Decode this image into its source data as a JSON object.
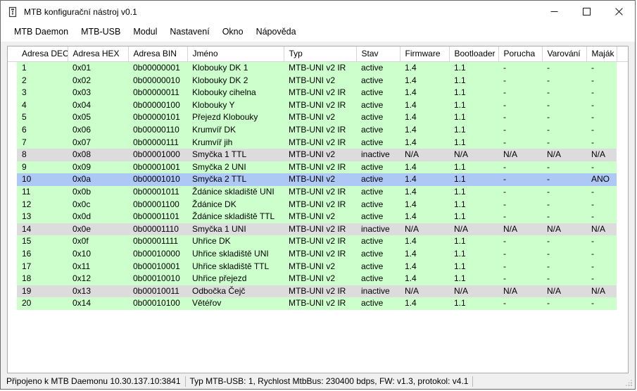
{
  "window": {
    "title": "MTB konfigurační nástroj v0.1",
    "app_icon": "module-icon",
    "minimize_label": "Minimalizovat",
    "maximize_label": "Maximalizovat",
    "close_label": "Zavřít"
  },
  "menu": {
    "items": [
      {
        "label": "MTB Daemon"
      },
      {
        "label": "MTB-USB"
      },
      {
        "label": "Modul"
      },
      {
        "label": "Nastavení"
      },
      {
        "label": "Okno"
      },
      {
        "label": "Nápověda"
      }
    ]
  },
  "table": {
    "columns": [
      {
        "key": "dec",
        "label": "Adresa DEC"
      },
      {
        "key": "hex",
        "label": "Adresa HEX"
      },
      {
        "key": "bin",
        "label": "Adresa BIN"
      },
      {
        "key": "name",
        "label": "Jméno"
      },
      {
        "key": "type",
        "label": "Typ"
      },
      {
        "key": "state",
        "label": "Stav"
      },
      {
        "key": "firmware",
        "label": "Firmware"
      },
      {
        "key": "bootloader",
        "label": "Bootloader"
      },
      {
        "key": "fault",
        "label": "Porucha"
      },
      {
        "key": "warning",
        "label": "Varování"
      },
      {
        "key": "beacon",
        "label": "Maják"
      }
    ],
    "rows": [
      {
        "dec": "1",
        "hex": "0x01",
        "bin": "0b00000001",
        "name": "Klobouky DK 1",
        "type": "MTB-UNI v2 IR",
        "state": "active",
        "firmware": "1.4",
        "bootloader": "1.1",
        "fault": "-",
        "warning": "-",
        "beacon": "-",
        "status": "active"
      },
      {
        "dec": "2",
        "hex": "0x02",
        "bin": "0b00000010",
        "name": "Klobouky DK 2",
        "type": "MTB-UNI v2",
        "state": "active",
        "firmware": "1.4",
        "bootloader": "1.1",
        "fault": "-",
        "warning": "-",
        "beacon": "-",
        "status": "active"
      },
      {
        "dec": "3",
        "hex": "0x03",
        "bin": "0b00000011",
        "name": "Klobouky cihelna",
        "type": "MTB-UNI v2 IR",
        "state": "active",
        "firmware": "1.4",
        "bootloader": "1.1",
        "fault": "-",
        "warning": "-",
        "beacon": "-",
        "status": "active"
      },
      {
        "dec": "4",
        "hex": "0x04",
        "bin": "0b00000100",
        "name": "Klobouky Y",
        "type": "MTB-UNI v2 IR",
        "state": "active",
        "firmware": "1.4",
        "bootloader": "1.1",
        "fault": "-",
        "warning": "-",
        "beacon": "-",
        "status": "active"
      },
      {
        "dec": "5",
        "hex": "0x05",
        "bin": "0b00000101",
        "name": "Přejezd Klobouky",
        "type": "MTB-UNI v2",
        "state": "active",
        "firmware": "1.4",
        "bootloader": "1.1",
        "fault": "-",
        "warning": "-",
        "beacon": "-",
        "status": "active"
      },
      {
        "dec": "6",
        "hex": "0x06",
        "bin": "0b00000110",
        "name": "Krumvíř DK",
        "type": "MTB-UNI v2 IR",
        "state": "active",
        "firmware": "1.4",
        "bootloader": "1.1",
        "fault": "-",
        "warning": "-",
        "beacon": "-",
        "status": "active"
      },
      {
        "dec": "7",
        "hex": "0x07",
        "bin": "0b00000111",
        "name": "Krumvíř jih",
        "type": "MTB-UNI v2 IR",
        "state": "active",
        "firmware": "1.4",
        "bootloader": "1.1",
        "fault": "-",
        "warning": "-",
        "beacon": "-",
        "status": "active"
      },
      {
        "dec": "8",
        "hex": "0x08",
        "bin": "0b00001000",
        "name": "Smyčka 1 TTL",
        "type": "MTB-UNI v2",
        "state": "inactive",
        "firmware": "N/A",
        "bootloader": "N/A",
        "fault": "N/A",
        "warning": "N/A",
        "beacon": "N/A",
        "status": "inactive"
      },
      {
        "dec": "9",
        "hex": "0x09",
        "bin": "0b00001001",
        "name": "Smyčka 2 UNI",
        "type": "MTB-UNI v2 IR",
        "state": "active",
        "firmware": "1.4",
        "bootloader": "1.1",
        "fault": "-",
        "warning": "-",
        "beacon": "-",
        "status": "active"
      },
      {
        "dec": "10",
        "hex": "0x0a",
        "bin": "0b00001010",
        "name": "Smyčka 2 TTL",
        "type": "MTB-UNI v2",
        "state": "active",
        "firmware": "1.4",
        "bootloader": "1.1",
        "fault": "-",
        "warning": "-",
        "beacon": "ANO",
        "status": "selected"
      },
      {
        "dec": "11",
        "hex": "0x0b",
        "bin": "0b00001011",
        "name": "Ždánice skladiště UNI",
        "type": "MTB-UNI v2 IR",
        "state": "active",
        "firmware": "1.4",
        "bootloader": "1.1",
        "fault": "-",
        "warning": "-",
        "beacon": "-",
        "status": "active"
      },
      {
        "dec": "12",
        "hex": "0x0c",
        "bin": "0b00001100",
        "name": "Ždánice DK",
        "type": "MTB-UNI v2 IR",
        "state": "active",
        "firmware": "1.4",
        "bootloader": "1.1",
        "fault": "-",
        "warning": "-",
        "beacon": "-",
        "status": "active"
      },
      {
        "dec": "13",
        "hex": "0x0d",
        "bin": "0b00001101",
        "name": "Ždánice skladiště TTL",
        "type": "MTB-UNI v2",
        "state": "active",
        "firmware": "1.4",
        "bootloader": "1.1",
        "fault": "-",
        "warning": "-",
        "beacon": "-",
        "status": "active"
      },
      {
        "dec": "14",
        "hex": "0x0e",
        "bin": "0b00001110",
        "name": "Smyčka 1 UNI",
        "type": "MTB-UNI v2 IR",
        "state": "inactive",
        "firmware": "N/A",
        "bootloader": "N/A",
        "fault": "N/A",
        "warning": "N/A",
        "beacon": "N/A",
        "status": "inactive"
      },
      {
        "dec": "15",
        "hex": "0x0f",
        "bin": "0b00001111",
        "name": "Uhřice DK",
        "type": "MTB-UNI v2 IR",
        "state": "active",
        "firmware": "1.4",
        "bootloader": "1.1",
        "fault": "-",
        "warning": "-",
        "beacon": "-",
        "status": "active"
      },
      {
        "dec": "16",
        "hex": "0x10",
        "bin": "0b00010000",
        "name": "Uhřice skladiště UNI",
        "type": "MTB-UNI v2 IR",
        "state": "active",
        "firmware": "1.4",
        "bootloader": "1.1",
        "fault": "-",
        "warning": "-",
        "beacon": "-",
        "status": "active"
      },
      {
        "dec": "17",
        "hex": "0x11",
        "bin": "0b00010001",
        "name": "Uhřice skladiště TTL",
        "type": "MTB-UNI v2",
        "state": "active",
        "firmware": "1.4",
        "bootloader": "1.1",
        "fault": "-",
        "warning": "-",
        "beacon": "-",
        "status": "active"
      },
      {
        "dec": "18",
        "hex": "0x12",
        "bin": "0b00010010",
        "name": "Uhřice přejezd",
        "type": "MTB-UNI v2",
        "state": "active",
        "firmware": "1.4",
        "bootloader": "1.1",
        "fault": "-",
        "warning": "-",
        "beacon": "-",
        "status": "active"
      },
      {
        "dec": "19",
        "hex": "0x13",
        "bin": "0b00010011",
        "name": "Odbočka Čejč",
        "type": "MTB-UNI v2 IR",
        "state": "inactive",
        "firmware": "N/A",
        "bootloader": "N/A",
        "fault": "N/A",
        "warning": "N/A",
        "beacon": "N/A",
        "status": "inactive"
      },
      {
        "dec": "20",
        "hex": "0x14",
        "bin": "0b00010100",
        "name": "Větéřov",
        "type": "MTB-UNI v2 IR",
        "state": "active",
        "firmware": "1.4",
        "bootloader": "1.1",
        "fault": "-",
        "warning": "-",
        "beacon": "-",
        "status": "active"
      }
    ]
  },
  "statusbar": {
    "connection": "Připojeno k MTB Daemonu 10.30.137.10:3841",
    "device": "Typ MTB-USB: 1, Rychlost MtbBus: 230400 bdps, FW: v1.3, protokol: v4.1"
  },
  "colors": {
    "row_active": "#ccffcc",
    "row_inactive": "#dcdcdc",
    "row_selected": "#aec8f5",
    "window_bg": "#f0f0f0",
    "border": "#acacac"
  }
}
